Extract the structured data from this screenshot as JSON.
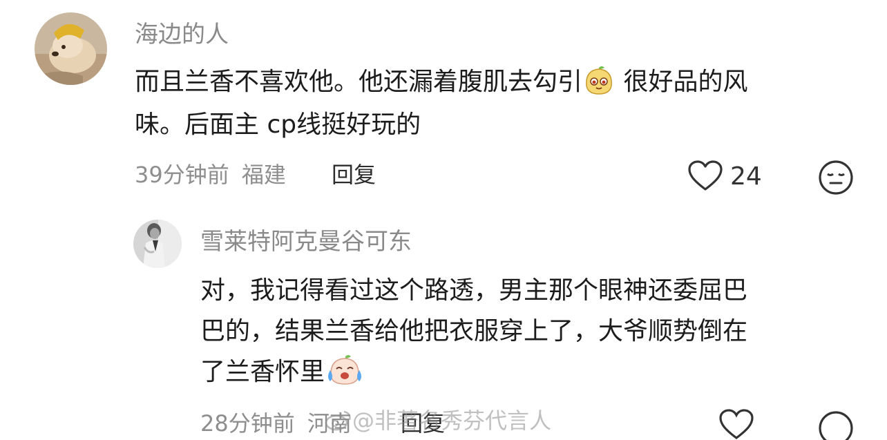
{
  "comment": {
    "username": "海边的人",
    "text_a": "而且兰香不喜欢他。他还漏着腹肌去勾引",
    "emoji_1": "smirk-bun-emoji",
    "text_b": "很好品的风",
    "text_c": "味。后面主 cp线挺好玩的",
    "time": "39分钟前",
    "location": "福建",
    "reply_label": "回复",
    "like_count": "24"
  },
  "reply": {
    "username": "雪莱特阿克曼谷可东",
    "line1": "对，我记得看过这个路透，男主那个眼神还委屈巴",
    "line2": "巴的，结果兰香给他把衣服穿上了，大爷顺势倒在",
    "line3": "了兰香怀里",
    "emoji_2": "crying-laugh-bun-emoji",
    "time": "28分钟前",
    "location": "河南",
    "reply_label": "回复"
  },
  "watermark": "@非著名秀芬代言人",
  "colors": {
    "text": "#1c1c1c",
    "meta": "#8e8e8e",
    "username": "#8a8a8a",
    "background": "#ffffff"
  }
}
